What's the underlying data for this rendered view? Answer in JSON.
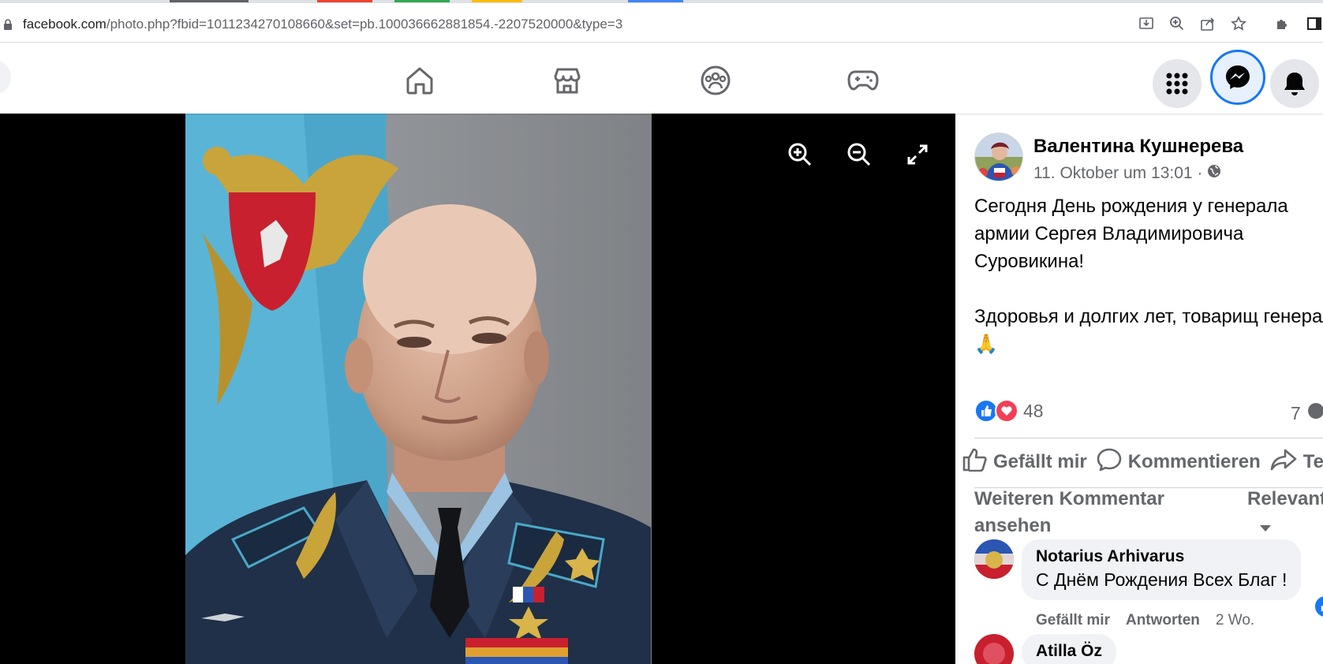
{
  "browser": {
    "tab_colors": [
      "#5f6368",
      "#ea4335",
      "#34a853",
      "#fbbc05",
      "#4285f4"
    ],
    "url_host": "facebook.com",
    "url_rest": "/photo.php?fbid=1011234270108660&set=pb.100036662881854.-2207520000&type=3",
    "omnibox_icons": [
      "install-icon",
      "zoom-icon",
      "share-icon",
      "bookmark-star-icon"
    ],
    "toolbar_icons": [
      "extensions-icon",
      "side-panel-icon"
    ]
  },
  "fb_nav": {
    "tabs": [
      "home-icon",
      "marketplace-icon",
      "groups-icon",
      "gaming-icon"
    ],
    "right_buttons": [
      "menu-grid-icon",
      "messenger-icon",
      "notifications-icon"
    ],
    "accent": "#1877f2"
  },
  "viewer": {
    "controls": [
      "zoom-in-icon",
      "zoom-out-icon",
      "fullscreen-icon"
    ]
  },
  "post": {
    "author": "Валентина Кушнерева",
    "date": "11. Oktober um 13:01 ·",
    "privacy_icon": "globe-icon",
    "text_lines": [
      "Сегодня День рождения у генерала",
      "армии Сергея Владимировича",
      "Суровикина!",
      "",
      "Здоровья и долгих лет, товарищ генерал!",
      "🙏"
    ],
    "reaction_icons": [
      "like-reaction-icon",
      "love-reaction-icon"
    ],
    "reaction_count": "48",
    "comment_count": "7"
  },
  "actions": {
    "like": "Gefällt mir",
    "comment": "Kommentieren",
    "share": "Teilen"
  },
  "comments_section": {
    "more_comments": [
      "Weiteren Kommentar",
      "ansehen"
    ],
    "sort_label": "Relevanteste"
  },
  "comments": [
    {
      "name": "Notarius Arhivarus",
      "text": "С Днём Рождения Всех Благ !",
      "like": "Gefällt mir",
      "reply": "Antworten",
      "time": "2 Wo."
    },
    {
      "name": "Atilla Öz",
      "text": ""
    }
  ]
}
